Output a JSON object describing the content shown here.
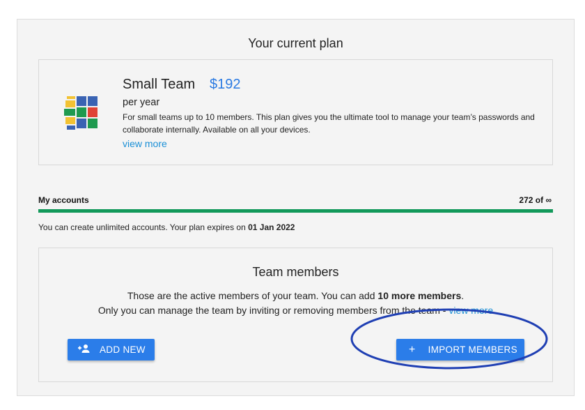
{
  "header": {
    "title": "Your current plan"
  },
  "plan": {
    "name": "Small Team",
    "price": "$192",
    "period": "per year",
    "description": "For small teams up to 10 members. This plan gives you the ultimate tool to manage your team’s passwords and collaborate internally. Available on all your devices.",
    "more_link": "view more",
    "logo_icon": "team-blocks-logo"
  },
  "accounts": {
    "label": "My accounts",
    "count": "272 of ∞",
    "progress_fraction": 1.0,
    "bar_color": "#12995a",
    "note_prefix": "You can create unlimited accounts. Your plan expires on ",
    "expiry": "01 Jan 2022"
  },
  "team": {
    "title": "Team members",
    "line1_prefix": "Those are the active members of your team. You can add ",
    "line1_bold": "10 more members",
    "line1_suffix": ".",
    "line2_text": "Only you can manage the team by inviting or removing members from the team - ",
    "line2_link": "view more",
    "add_button": {
      "label": "ADD NEW",
      "icon": "person-add-icon"
    },
    "import_button": {
      "label": "IMPORT MEMBERS",
      "icon": "plus-icon"
    }
  },
  "colors": {
    "accent": "#2b7de9",
    "link": "#1a8fd6",
    "price": "#2a7ae2",
    "highlight": "#1f3fb3"
  }
}
